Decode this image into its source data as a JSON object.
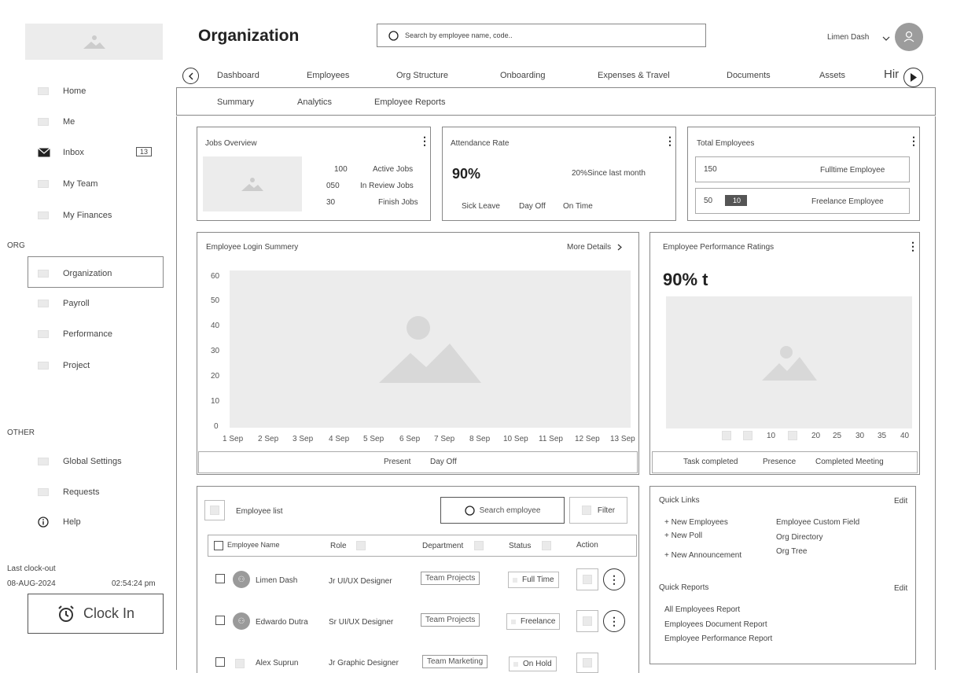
{
  "header": {
    "title": "Organization",
    "search_placeholder": "Search by employee name, code..",
    "user_name": "Limen Dash"
  },
  "sidebar": {
    "items_top": [
      {
        "label": "Home",
        "icon": "image-placeholder-icon"
      },
      {
        "label": "Me",
        "icon": "image-placeholder-icon"
      },
      {
        "label": "Inbox",
        "icon": "envelope-icon",
        "badge": "13"
      },
      {
        "label": "My Team",
        "icon": "image-placeholder-icon"
      },
      {
        "label": "My Finances",
        "icon": "image-placeholder-icon"
      }
    ],
    "org_label": "ORG",
    "items_org": [
      {
        "label": "Organization",
        "icon": "image-placeholder-icon"
      },
      {
        "label": "Payroll",
        "icon": "image-placeholder-icon"
      },
      {
        "label": "Performance",
        "icon": "image-placeholder-icon"
      },
      {
        "label": "Project",
        "icon": "image-placeholder-icon"
      }
    ],
    "other_label": "OTHER",
    "items_other": [
      {
        "label": "Global Settings",
        "icon": "image-placeholder-icon"
      },
      {
        "label": "Requests",
        "icon": "image-placeholder-icon"
      },
      {
        "label": "Help",
        "icon": "info-icon"
      }
    ],
    "clock": {
      "last_label": "Last clock-out",
      "date": "08-AUG-2024",
      "time": "02:54:24 pm",
      "button": "Clock In"
    }
  },
  "tabs": [
    "Dashboard",
    "Employees",
    "Org Structure",
    "Onboarding",
    "Expenses & Travel",
    "Documents",
    "Assets",
    "Hir"
  ],
  "subtabs": [
    "Summary",
    "Analytics",
    "Employee Reports"
  ],
  "jobs_overview": {
    "title": "Jobs Overview",
    "rows": [
      {
        "value": "100",
        "label": "Active Jobs"
      },
      {
        "value": "050",
        "label": "In Review Jobs"
      },
      {
        "value": "30",
        "label": "Finish Jobs"
      }
    ]
  },
  "attendance": {
    "title": "Attendance Rate",
    "value": "90%",
    "change": "20%Since last month",
    "legend": [
      "Sick Leave",
      "Day Off",
      "On Time"
    ]
  },
  "total_employees": {
    "title": "Total Employees",
    "fulltime_value": "150",
    "fulltime_label": "Fulltime Employee",
    "freelance_value": "50",
    "freelance_badge": "10",
    "freelance_label": "Freelance Employee"
  },
  "login_chart": {
    "title": "Employee Login Summery",
    "more": "More Details",
    "y_ticks": [
      "60",
      "50",
      "40",
      "30",
      "20",
      "10",
      "0"
    ],
    "x_ticks": [
      "1 Sep",
      "2 Sep",
      "3 Sep",
      "4 Sep",
      "5 Sep",
      "6 Sep",
      "7 Sep",
      "8 Sep",
      "10 Sep",
      "11 Sep",
      "12 Sep",
      "13 Sep"
    ],
    "legend": [
      "Present",
      "Day Off"
    ]
  },
  "performance": {
    "title": "Employee Performance Ratings",
    "value": "90% t",
    "x_ticks": [
      "10",
      "20",
      "25",
      "30",
      "35",
      "40"
    ],
    "legend": [
      "Task completed",
      "Presence",
      "Completed Meeting"
    ]
  },
  "employee_list": {
    "title": "Employee list",
    "search_placeholder": "Search employee",
    "filter": "Filter",
    "columns": [
      "Employee Name",
      "Role",
      "Department",
      "Status",
      "Action"
    ],
    "rows": [
      {
        "name": "Limen Dash",
        "role": "Jr UI/UX Designer",
        "department": "Team Projects",
        "status": "Full Time"
      },
      {
        "name": "Edwardo Dutra",
        "role": "Sr UI/UX Designer",
        "department": "Team Projects",
        "status": "Freelance"
      },
      {
        "name": "Alex Suprun",
        "role": "Jr Graphic Designer",
        "department": "Team Marketing",
        "status": "On Hold"
      }
    ]
  },
  "quick_links": {
    "title": "Quick Links",
    "edit": "Edit",
    "links_left": [
      "+ New Employees",
      "+ New Poll",
      "+ New Announcement"
    ],
    "links_right": [
      "Employee Custom Field",
      "Org Directory",
      "Org Tree"
    ],
    "reports_title": "Quick Reports",
    "reports_edit": "Edit",
    "reports": [
      "All Employees Report",
      "Employees Document Report",
      "Employee Performance Report"
    ]
  }
}
